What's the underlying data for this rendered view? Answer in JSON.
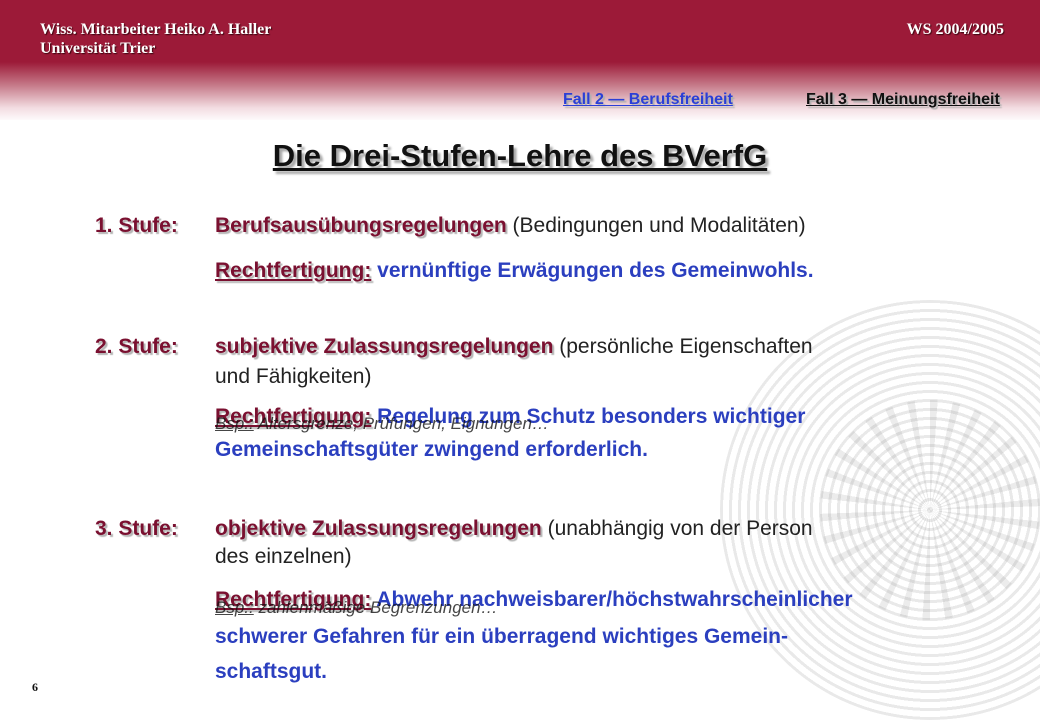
{
  "header": {
    "author": "Wiss. Mitarbeiter Heiko A. Haller",
    "university": "Universität Trier",
    "semester": "WS 2004/2005"
  },
  "nav": {
    "fall2": "Fall 2 — Berufsfreiheit",
    "fall3": "Fall 3 — Meinungsfreiheit"
  },
  "title": "Die Drei-Stufen-Lehre des BVerfG",
  "stufen": [
    {
      "label": "1. Stufe:",
      "term": "Berufsausübungsregelungen",
      "desc_1": " (Bedingungen und Modalitäten)",
      "desc_2": "",
      "rf_label": "Rechtfertigung:",
      "rf_text_1": " vernünftige Erwägungen des Gemeinwohls.",
      "rf_text_2": "",
      "rf_text_3": "",
      "example": ""
    },
    {
      "label": "2. Stufe:",
      "term": "subjektive Zulassungsregelungen",
      "desc_1": " (persönliche Eigenschaften",
      "desc_2": "und Fähigkeiten)",
      "rf_label": "Rechtfertigung:",
      "rf_text_1": " Regelung zum Schutz besonders wichtiger",
      "rf_text_2": "Gemeinschaftsgüter zwingend erforderlich.",
      "rf_text_3": "",
      "example_label": "Bsp.:",
      "example": " Altersgrenze, Prüfungen, Eignungen…"
    },
    {
      "label": "3. Stufe:",
      "term": "objektive Zulassungsregelungen",
      "desc_1": " (unabhängig von der Person",
      "desc_2": "des einzelnen)",
      "rf_label": "Rechtfertigung:",
      "rf_text_1": " Abwehr nachweisbarer/höchstwahrscheinlicher",
      "rf_text_2": "schwerer Gefahren für ein überragend wichtiges Gemein-",
      "rf_text_3": "schaftsgut.",
      "example_label": "Bsp.:",
      "example": " zahlenmäßige Begrenzungen…"
    }
  ],
  "page_number": "6",
  "colors": {
    "header_band": "#9c1a38",
    "term": "#7a1030",
    "justification": "#2b3fbf"
  }
}
